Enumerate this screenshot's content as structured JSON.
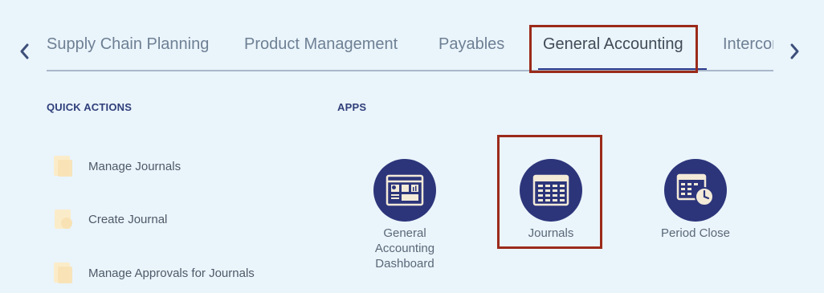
{
  "nav": {
    "tabs": [
      {
        "label": "Supply Chain Planning"
      },
      {
        "label": "Product Management"
      },
      {
        "label": "Payables"
      },
      {
        "label": "General Accounting",
        "selected": true
      },
      {
        "label": "Intercompany Accounting"
      }
    ]
  },
  "quick_actions": {
    "title": "QUICK ACTIONS",
    "items": [
      {
        "label": "Manage Journals",
        "icon": "journal-icon"
      },
      {
        "label": "Create Journal",
        "icon": "create-icon"
      },
      {
        "label": "Manage Approvals for Journals",
        "icon": "approvals-icon"
      }
    ]
  },
  "apps": {
    "title": "APPS",
    "items": [
      {
        "label": "General Accounting Dashboard",
        "icon": "dashboard-icon"
      },
      {
        "label": "Journals",
        "icon": "journals-icon"
      },
      {
        "label": "Period Close",
        "icon": "period-close-icon"
      }
    ]
  },
  "colors": {
    "background": "#eaf4fb",
    "app_circle": "#2c357a",
    "highlight": "#9b2a1a",
    "section_title": "#2f3f7a"
  }
}
